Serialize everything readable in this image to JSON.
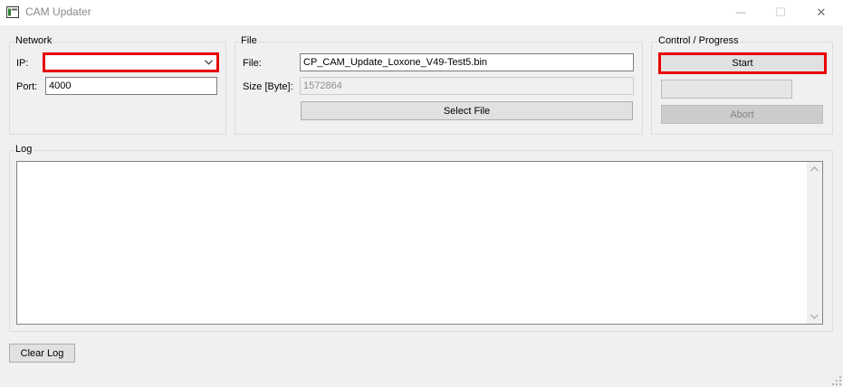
{
  "window": {
    "title": "CAM Updater",
    "minimize_glyph": "—",
    "maximize_glyph": "☐",
    "close_glyph": "✕",
    "icon": "app-window-icon"
  },
  "network": {
    "group_label": "Network",
    "ip_label": "IP:",
    "ip_value": "",
    "port_label": "Port:",
    "port_value": "4000"
  },
  "file": {
    "group_label": "File",
    "file_label": "File:",
    "file_value": "CP_CAM_Update_Loxone_V49-Test5.bin",
    "size_label": "Size [Byte]:",
    "size_value": "1572864",
    "select_button": "Select File"
  },
  "control": {
    "group_label": "Control / Progress",
    "start_button": "Start",
    "abort_button": "Abort",
    "progress": 0
  },
  "log": {
    "group_label": "Log",
    "content": "",
    "clear_button": "Clear Log"
  },
  "colors": {
    "highlight": "#e60000",
    "window_bg": "#f0f0f0"
  }
}
